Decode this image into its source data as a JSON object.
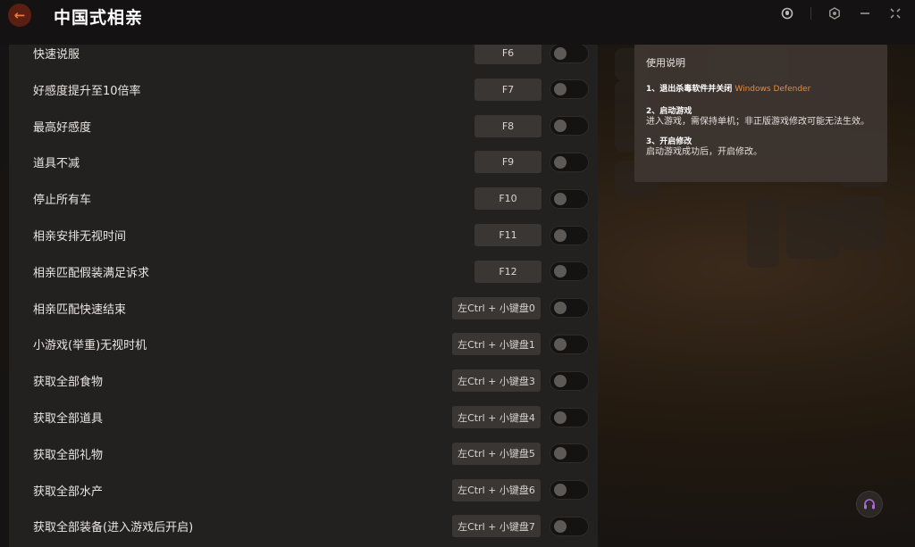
{
  "app": {
    "title": "中国式相亲",
    "accent_color": "#f07a2a"
  },
  "titlebar": {
    "back_icon": "back-arrow-icon",
    "controls": [
      "notification-icon",
      "settings-icon",
      "minimize-icon",
      "close-icon"
    ]
  },
  "cheats": [
    {
      "label": "快速说服",
      "hotkey": "F6",
      "enabled": false
    },
    {
      "label": "好感度提升至10倍率",
      "hotkey": "F7",
      "enabled": false
    },
    {
      "label": "最高好感度",
      "hotkey": "F8",
      "enabled": false
    },
    {
      "label": "道具不减",
      "hotkey": "F9",
      "enabled": false
    },
    {
      "label": "停止所有车",
      "hotkey": "F10",
      "enabled": false
    },
    {
      "label": "相亲安排无视时间",
      "hotkey": "F11",
      "enabled": false
    },
    {
      "label": "相亲匹配假装满足诉求",
      "hotkey": "F12",
      "enabled": false
    },
    {
      "label": "相亲匹配快速结束",
      "hotkey": "左Ctrl + 小键盘0",
      "enabled": false
    },
    {
      "label": "小游戏(举重)无视时机",
      "hotkey": "左Ctrl + 小键盘1",
      "enabled": false
    },
    {
      "label": "获取全部食物",
      "hotkey": "左Ctrl + 小键盘3",
      "enabled": false
    },
    {
      "label": "获取全部道具",
      "hotkey": "左Ctrl + 小键盘4",
      "enabled": false
    },
    {
      "label": "获取全部礼物",
      "hotkey": "左Ctrl + 小键盘5",
      "enabled": false
    },
    {
      "label": "获取全部水产",
      "hotkey": "左Ctrl + 小键盘6",
      "enabled": false
    },
    {
      "label": "获取全部装备(进入游戏后开启)",
      "hotkey": "左Ctrl + 小键盘7",
      "enabled": false
    }
  ],
  "info": {
    "title": "使用说明",
    "step1_title": "1、退出杀毒软件并关闭",
    "step1_highlight": "Windows Defender",
    "step2_title": "2、启动游戏",
    "step2_body": "进入游戏，需保持单机；非正版游戏修改可能无法生效。",
    "step3_title": "3、开启修改",
    "step3_body": "启动游戏成功后，开启修改。"
  },
  "support": {
    "icon": "headset-icon"
  }
}
